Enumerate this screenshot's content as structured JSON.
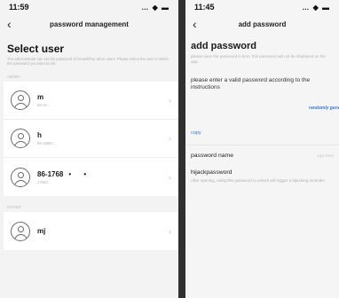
{
  "left_screen": {
    "status": {
      "time": "11:59",
      "signal": "… ◆ ▬"
    },
    "nav": {
      "back": "‹",
      "title": "password management"
    },
    "heading": "Select user",
    "subtitle": "The administrator can set the password of himself/her other users. Please select the user to which the password you want to set.",
    "groups": [
      {
        "label": "ADMIN",
        "users": [
          {
            "name": "m",
            "id": "86-18…",
            "dots": ""
          },
          {
            "name": "h",
            "id": "86-15887…",
            "dots": ""
          },
          {
            "name": "86-1768",
            "id": "17683…",
            "dots": "• •"
          }
        ]
      },
      {
        "label": "OTHER",
        "users": [
          {
            "name": "mj",
            "id": "",
            "dots": ""
          }
        ]
      }
    ],
    "chevron": "›"
  },
  "right_screen": {
    "status": {
      "time": "11:45",
      "signal": "… ◆ ▬"
    },
    "nav": {
      "back": "‹",
      "title": "add password"
    },
    "heading": "add password",
    "subtitle": "please save the password in time, this password will not be displayed on the app.",
    "instruction": "please enter a valid password according to the instructions",
    "randomly_generate": "randomly generat",
    "copy": "copy",
    "password_name_label": "password name",
    "password_name_placeholder": "type here",
    "hijack_label": "hijackpassword",
    "hijack_desc": "After opening, using this password to unlock will trigger a hijacking reminder"
  }
}
